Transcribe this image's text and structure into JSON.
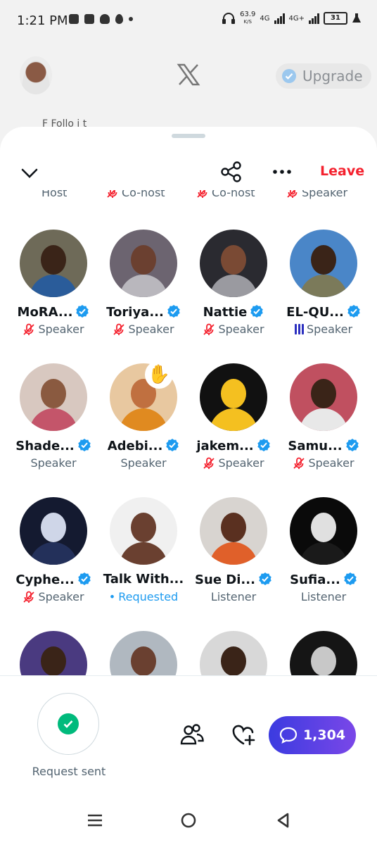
{
  "status_bar": {
    "time": "1:21 PM",
    "net_speed": "63.9",
    "net_speed_unit": "K/S",
    "network_1": "4G",
    "network_2": "4G+",
    "battery": "31"
  },
  "header": {
    "upgrade_label": "Upgrade",
    "tabs_ghost": "F             Follo i            t"
  },
  "space": {
    "leave_label": "Leave",
    "top_roles": [
      "Host",
      "Co-host",
      "Co-host",
      "Speaker"
    ],
    "participants": [
      {
        "name": "MoRA...",
        "verified": true,
        "role": "Speaker",
        "role_icon": "muted",
        "photo": {
          "bg": "#6e6a58",
          "face": "#3a2418",
          "body": "#2a5c9a"
        }
      },
      {
        "name": "Toriya...",
        "verified": true,
        "role": "Speaker",
        "role_icon": "muted",
        "photo": {
          "bg": "#6c6470",
          "face": "#6b4030",
          "body": "#b9b7bd"
        }
      },
      {
        "name": "Nattie",
        "verified": true,
        "role": "Speaker",
        "role_icon": "muted",
        "photo": {
          "bg": "#2a2a30",
          "face": "#7a4a34",
          "body": "#9a9aa0"
        }
      },
      {
        "name": "EL-QU...",
        "verified": true,
        "role": "Speaker",
        "role_icon": "speaking",
        "photo": {
          "bg": "#4a86c8",
          "face": "#3a2418",
          "body": "#7b7a5a"
        }
      },
      {
        "name": "Shade...",
        "verified": true,
        "role": "Speaker",
        "role_icon": "none",
        "photo": {
          "bg": "#d8c8c0",
          "face": "#8a5a40",
          "body": "#c4556a"
        }
      },
      {
        "name": "Adebi...",
        "verified": true,
        "role": "Speaker",
        "role_icon": "none",
        "hand_raised": true,
        "hand_icon": "raised-hand-icon",
        "photo": {
          "bg": "#e8c8a0",
          "face": "#c07040",
          "body": "#e08a20"
        }
      },
      {
        "name": "jakem...",
        "verified": true,
        "role": "Speaker",
        "role_icon": "muted",
        "photo": {
          "bg": "#111111",
          "face": "#f4c020",
          "body": "#f4c020"
        }
      },
      {
        "name": "Samu...",
        "verified": true,
        "role": "Speaker",
        "role_icon": "muted",
        "photo": {
          "bg": "#c05060",
          "face": "#3a2418",
          "body": "#e8e8e8"
        }
      },
      {
        "name": "Cyphe...",
        "verified": true,
        "role": "Speaker",
        "role_icon": "muted",
        "photo": {
          "bg": "#141a30",
          "face": "#cfd6e8",
          "body": "#23305a"
        }
      },
      {
        "name": "Talk With...",
        "verified": false,
        "role": "Requested",
        "role_icon": "dot",
        "photo": {
          "bg": "#f0f0f0",
          "face": "#6a4030",
          "body": "#6a4030"
        }
      },
      {
        "name": "Sue Di...",
        "verified": true,
        "role": "Listener",
        "role_icon": "none",
        "photo": {
          "bg": "#d8d4d0",
          "face": "#5a3020",
          "body": "#e0602a"
        }
      },
      {
        "name": "Sufia...",
        "verified": true,
        "role": "Listener",
        "role_icon": "none",
        "photo": {
          "bg": "#0a0a0a",
          "face": "#e0e0e0",
          "body": "#1a1a1a"
        }
      },
      {
        "name": "",
        "verified": false,
        "role": "",
        "role_icon": "none",
        "photo": {
          "bg": "#4a3a80",
          "face": "#3a2418",
          "body": "#1a1a40"
        }
      },
      {
        "name": "",
        "verified": false,
        "role": "",
        "role_icon": "none",
        "photo": {
          "bg": "#b0b8c0",
          "face": "#6a4030",
          "body": "#8a7050"
        }
      },
      {
        "name": "",
        "verified": false,
        "role": "",
        "role_icon": "none",
        "photo": {
          "bg": "#d8d8d8",
          "face": "#3a2418",
          "body": "#222222"
        }
      },
      {
        "name": "",
        "verified": false,
        "role": "",
        "role_icon": "none",
        "photo": {
          "bg": "#151515",
          "face": "#c8c8c8",
          "body": "#444444"
        }
      }
    ]
  },
  "bottom_bar": {
    "request_label": "Request sent",
    "chat_count": "1,304"
  },
  "colors": {
    "accent_blue": "#1d9bf0",
    "leave_red": "#f4212e",
    "muted_red": "#f4212e",
    "success_green": "#00ba7c"
  }
}
